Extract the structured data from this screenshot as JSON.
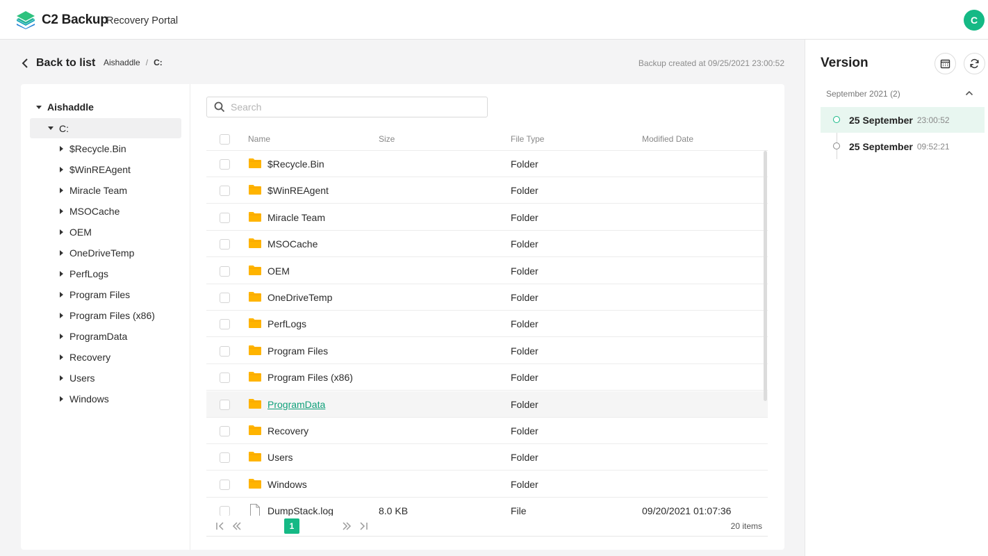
{
  "header": {
    "brand": "C2 Backup",
    "subtitle": "Recovery Portal",
    "avatar_initial": "C",
    "logo_icon": "stacked-layers-logo"
  },
  "nav": {
    "back_label": "Back to list",
    "breadcrumb": [
      "Aishaddle",
      "C:"
    ],
    "separator": "/",
    "backup_created": "Backup created at 09/25/2021 23:00:52"
  },
  "tree": {
    "root": "Aishaddle",
    "drive": "C:",
    "items": [
      "$Recycle.Bin",
      "$WinREAgent",
      "Miracle Team",
      "MSOCache",
      "OEM",
      "OneDriveTemp",
      "PerfLogs",
      "Program Files",
      "Program Files (x86)",
      "ProgramData",
      "Recovery",
      "Users",
      "Windows"
    ]
  },
  "search": {
    "placeholder": "Search",
    "value": ""
  },
  "table": {
    "columns": [
      "Name",
      "Size",
      "File Type",
      "Modified Date"
    ],
    "rows": [
      {
        "name": "$Recycle.Bin",
        "size": "",
        "type": "Folder",
        "modified": "",
        "icon": "folder-icon"
      },
      {
        "name": "$WinREAgent",
        "size": "",
        "type": "Folder",
        "modified": "",
        "icon": "folder-icon"
      },
      {
        "name": "Miracle Team",
        "size": "",
        "type": "Folder",
        "modified": "",
        "icon": "folder-icon"
      },
      {
        "name": "MSOCache",
        "size": "",
        "type": "Folder",
        "modified": "",
        "icon": "folder-icon"
      },
      {
        "name": "OEM",
        "size": "",
        "type": "Folder",
        "modified": "",
        "icon": "folder-icon"
      },
      {
        "name": "OneDriveTemp",
        "size": "",
        "type": "Folder",
        "modified": "",
        "icon": "folder-icon"
      },
      {
        "name": "PerfLogs",
        "size": "",
        "type": "Folder",
        "modified": "",
        "icon": "folder-icon"
      },
      {
        "name": "Program Files",
        "size": "",
        "type": "Folder",
        "modified": "",
        "icon": "folder-icon"
      },
      {
        "name": "Program Files (x86)",
        "size": "",
        "type": "Folder",
        "modified": "",
        "icon": "folder-icon"
      },
      {
        "name": "ProgramData",
        "size": "",
        "type": "Folder",
        "modified": "",
        "icon": "folder-icon"
      },
      {
        "name": "Recovery",
        "size": "",
        "type": "Folder",
        "modified": "",
        "icon": "folder-icon"
      },
      {
        "name": "Users",
        "size": "",
        "type": "Folder",
        "modified": "",
        "icon": "folder-icon"
      },
      {
        "name": "Windows",
        "size": "",
        "type": "Folder",
        "modified": "",
        "icon": "folder-icon"
      },
      {
        "name": "DumpStack.log",
        "size": "8.0 KB",
        "type": "File",
        "modified": "09/20/2021 01:07:36",
        "icon": "file-icon"
      }
    ]
  },
  "pagination": {
    "current_page": "1",
    "total_items": "20 items"
  },
  "versions": {
    "title": "Version",
    "month_group": "September 2021 (2)",
    "entries": [
      {
        "date": "25 September",
        "time": "23:00:52"
      },
      {
        "date": "25 September",
        "time": "09:52:21"
      }
    ]
  },
  "colors": {
    "accent": "#15b985",
    "folder": "#ffb400",
    "link": "#0fa07a",
    "version_highlight": "#e8f6f0"
  }
}
